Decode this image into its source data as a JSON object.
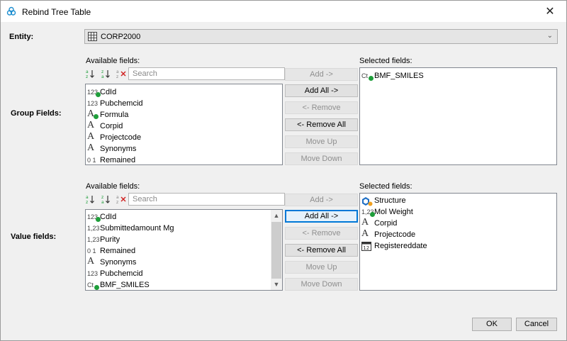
{
  "window": {
    "title": "Rebind Tree Table",
    "close_glyph": "✕"
  },
  "entity": {
    "label": "Entity:",
    "value": "CORP2000",
    "chevron": "⌄"
  },
  "group_section": {
    "label": "Group Fields:",
    "available_label": "Available fields:",
    "selected_label": "Selected fields:",
    "search_placeholder": "Search",
    "available_items": [
      {
        "icon": "numeric-key-icon",
        "badge": "123",
        "text": "CdId"
      },
      {
        "icon": "numeric-icon",
        "badge": "123",
        "text": "Pubchemcid"
      },
      {
        "icon": "text-key-icon",
        "badge": "A",
        "text": "Formula"
      },
      {
        "icon": "text-icon",
        "badge": "A",
        "text": "Corpid"
      },
      {
        "icon": "text-icon",
        "badge": "A",
        "text": "Projectcode"
      },
      {
        "icon": "text-icon",
        "badge": "A",
        "text": "Synonyms"
      },
      {
        "icon": "boolean-icon",
        "badge": "0 1",
        "text": "Remained"
      }
    ],
    "selected_items": [
      {
        "icon": "chemterm-key-icon",
        "badge": "Ct",
        "text": "BMF_SMILES"
      }
    ],
    "buttons": {
      "add": "Add ->",
      "add_all": "Add All ->",
      "remove": "<- Remove",
      "remove_all": "<- Remove All",
      "move_up": "Move Up",
      "move_down": "Move Down"
    }
  },
  "value_section": {
    "label": "Value fields:",
    "available_label": "Available fields:",
    "selected_label": "Selected fields:",
    "search_placeholder": "Search",
    "available_items": [
      {
        "icon": "numeric-key-icon",
        "badge": "123",
        "text": "CdId"
      },
      {
        "icon": "decimal-icon",
        "badge": "1,23",
        "text": "Submittedamount Mg"
      },
      {
        "icon": "decimal-icon",
        "badge": "1,23",
        "text": "Purity"
      },
      {
        "icon": "boolean-icon",
        "badge": "0 1",
        "text": "Remained"
      },
      {
        "icon": "text-icon",
        "badge": "A",
        "text": "Synonyms"
      },
      {
        "icon": "numeric-icon",
        "badge": "123",
        "text": "Pubchemcid"
      },
      {
        "icon": "chemterm-key-icon",
        "badge": "Ct",
        "text": "BMF_SMILES"
      }
    ],
    "selected_items": [
      {
        "icon": "structure-icon",
        "badge": "",
        "text": "Structure"
      },
      {
        "icon": "decimal-key-icon",
        "badge": "1,23",
        "text": "Mol Weight"
      },
      {
        "icon": "text-icon",
        "badge": "A",
        "text": "Corpid"
      },
      {
        "icon": "text-icon",
        "badge": "A",
        "text": "Projectcode"
      },
      {
        "icon": "date-icon",
        "badge": "12",
        "text": "Registereddate"
      }
    ],
    "buttons": {
      "add": "Add ->",
      "add_all": "Add All ->",
      "remove": "<- Remove",
      "remove_all": "<- Remove All",
      "move_up": "Move Up",
      "move_down": "Move Down"
    }
  },
  "footer": {
    "ok": "OK",
    "cancel": "Cancel"
  },
  "colors": {
    "accent": "#0078d7",
    "key_dot": "#1e9e3a",
    "structure_blue": "#1f6fc5",
    "structure_orange": "#f0a020"
  }
}
